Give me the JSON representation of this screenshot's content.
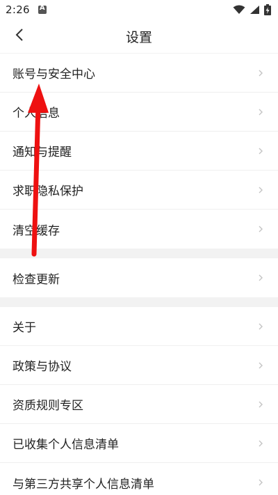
{
  "status_bar": {
    "time": "2:26",
    "left_icon": "a-notification-icon",
    "icons": [
      "wifi-icon",
      "signal-icon",
      "battery-charging-icon"
    ]
  },
  "nav": {
    "title": "设置",
    "back_icon": "chevron-left-icon"
  },
  "sections": [
    {
      "items": [
        {
          "label": "账号与安全中心"
        },
        {
          "label": "个人信息"
        },
        {
          "label": "通知与提醒"
        },
        {
          "label": "求职隐私保护"
        },
        {
          "label": "清空缓存"
        }
      ]
    },
    {
      "items": [
        {
          "label": "检查更新"
        }
      ]
    },
    {
      "items": [
        {
          "label": "关于"
        },
        {
          "label": "政策与协议"
        },
        {
          "label": "资质规则专区"
        },
        {
          "label": "已收集个人信息清单"
        },
        {
          "label": "与第三方共享个人信息清单"
        }
      ]
    }
  ],
  "colors": {
    "annotation_arrow": "#ee1111",
    "divider": "#efefef",
    "section_gap": "#f2f2f2"
  }
}
